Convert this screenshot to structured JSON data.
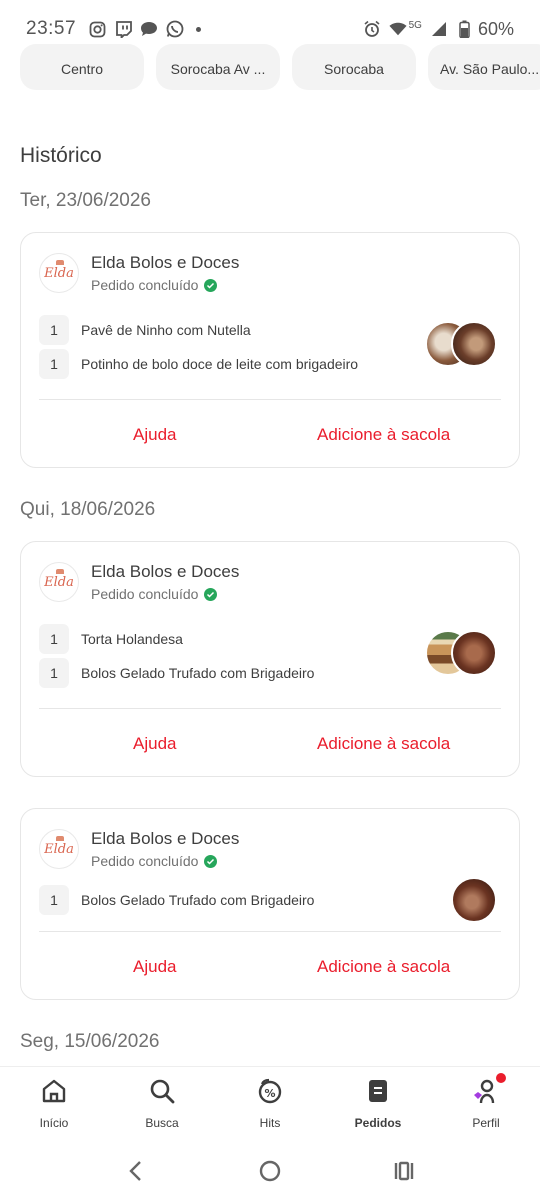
{
  "status_bar": {
    "time": "23:57",
    "network": "5G",
    "battery": "60%",
    "icons": [
      "instagram-icon",
      "twitch-icon",
      "chat-icon",
      "whatsapp-icon",
      "alarm-icon",
      "wifi-icon",
      "signal-icon",
      "battery-icon"
    ]
  },
  "chips": [
    "Centro",
    "Sorocaba Av ...",
    "Sorocaba",
    "Av. São Paulo..."
  ],
  "section_title": "Histórico",
  "groups": [
    {
      "date": "Ter, 23/06/2026",
      "orders": [
        {
          "store": "Elda Bolos e Doces",
          "status": "Pedido concluído",
          "items": [
            {
              "qty": "1",
              "name": "Pavê de Ninho com Nutella"
            },
            {
              "qty": "1",
              "name": "Potinho de bolo doce de leite com brigadeiro"
            }
          ],
          "help": "Ajuda",
          "add": "Adicione à sacola"
        }
      ]
    },
    {
      "date": "Qui, 18/06/2026",
      "orders": [
        {
          "store": "Elda Bolos e Doces",
          "status": "Pedido concluído",
          "items": [
            {
              "qty": "1",
              "name": "Torta Holandesa"
            },
            {
              "qty": "1",
              "name": "Bolos Gelado Trufado com Brigadeiro"
            }
          ],
          "help": "Ajuda",
          "add": "Adicione à sacola"
        },
        {
          "store": "Elda Bolos e Doces",
          "status": "Pedido concluído",
          "items": [
            {
              "qty": "1",
              "name": "Bolos Gelado Trufado com Brigadeiro"
            }
          ],
          "help": "Ajuda",
          "add": "Adicione à sacola"
        }
      ]
    },
    {
      "date": "Seg, 15/06/2026",
      "orders": []
    }
  ],
  "logo_text": "Elda",
  "bottom_nav": [
    {
      "label": "Início",
      "icon": "home-icon"
    },
    {
      "label": "Busca",
      "icon": "search-icon"
    },
    {
      "label": "Hits",
      "icon": "discount-icon"
    },
    {
      "label": "Pedidos",
      "icon": "orders-icon",
      "active": true
    },
    {
      "label": "Perfil",
      "icon": "profile-icon"
    }
  ],
  "colors": {
    "accent": "#ea1d2c",
    "success": "#26a65b"
  }
}
